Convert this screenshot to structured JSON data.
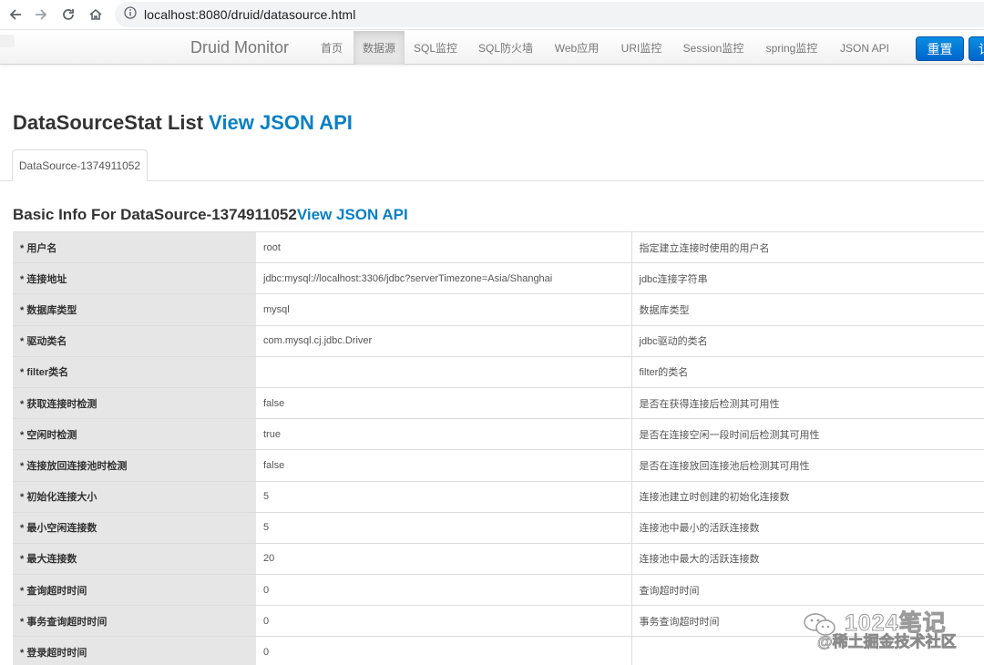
{
  "browser": {
    "url": "localhost:8080/druid/datasource.html",
    "icons": [
      "back-arrow-icon",
      "forward-arrow-icon",
      "reload-icon",
      "home-icon",
      "info-icon"
    ]
  },
  "navbar": {
    "brand": "Druid Monitor",
    "items": [
      {
        "label": "首页",
        "active": false
      },
      {
        "label": "数据源",
        "active": true
      },
      {
        "label": "SQL监控",
        "active": false
      },
      {
        "label": "SQL防火墙",
        "active": false
      },
      {
        "label": "Web应用",
        "active": false
      },
      {
        "label": "URI监控",
        "active": false
      },
      {
        "label": "Session监控",
        "active": false
      },
      {
        "label": "spring监控",
        "active": false
      },
      {
        "label": "JSON API",
        "active": false
      }
    ],
    "reset_button": "重置",
    "more_button": "记"
  },
  "page": {
    "title": "DataSourceStat List ",
    "title_link": "View JSON API",
    "tab_label": "DataSource-1374911052",
    "section_title": "Basic Info For DataSource-1374911052",
    "section_link": "View JSON API"
  },
  "rows": [
    {
      "label": "* 用户名",
      "value": "root",
      "desc": "指定建立连接时使用的用户名"
    },
    {
      "label": "* 连接地址",
      "value": "jdbc:mysql://localhost:3306/jdbc?serverTimezone=Asia/Shanghai",
      "desc": "jdbc连接字符串"
    },
    {
      "label": "* 数据库类型",
      "value": "mysql",
      "desc": "数据库类型"
    },
    {
      "label": "* 驱动类名",
      "value": "com.mysql.cj.jdbc.Driver",
      "desc": "jdbc驱动的类名"
    },
    {
      "label": "* filter类名",
      "value": "",
      "desc": "filter的类名"
    },
    {
      "label": "* 获取连接时检测",
      "value": "false",
      "desc": "是否在获得连接后检测其可用性"
    },
    {
      "label": "* 空闲时检测",
      "value": "true",
      "desc": "是否在连接空闲一段时间后检测其可用性"
    },
    {
      "label": "* 连接放回连接池时检测",
      "value": "false",
      "desc": "是否在连接放回连接池后检测其可用性"
    },
    {
      "label": "* 初始化连接大小",
      "value": "5",
      "desc": "连接池建立时创建的初始化连接数"
    },
    {
      "label": "* 最小空闲连接数",
      "value": "5",
      "desc": "连接池中最小的活跃连接数"
    },
    {
      "label": "* 最大连接数",
      "value": "20",
      "desc": "连接池中最大的活跃连接数"
    },
    {
      "label": "* 查询超时时间",
      "value": "0",
      "desc": "查询超时时间"
    },
    {
      "label": "* 事务查询超时时间",
      "value": "0",
      "desc": "事务查询超时时间"
    },
    {
      "label": "* 登录超时时间",
      "value": "0",
      "desc": ""
    }
  ],
  "watermark": {
    "title": "1024笔记",
    "subtitle": "@稀土掘金技术社区",
    "icon": "wechat-icon"
  },
  "colors": {
    "link": "#0a7fc2",
    "button": "#0a7fd6",
    "label_bg": "#e6e6e6"
  }
}
